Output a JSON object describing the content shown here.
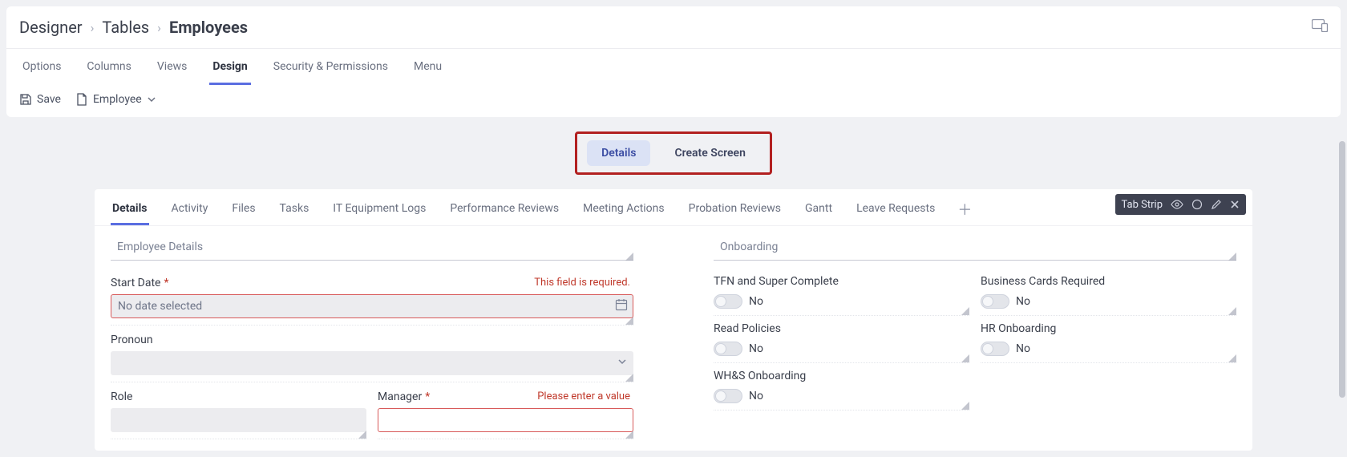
{
  "breadcrumbs": {
    "root": "Designer",
    "mid": "Tables",
    "current": "Employees"
  },
  "main_tabs": [
    "Options",
    "Columns",
    "Views",
    "Design",
    "Security & Permissions",
    "Menu"
  ],
  "main_tabs_active": "Design",
  "toolbar": {
    "save": "Save",
    "form_picker": "Employee"
  },
  "mode": {
    "details": "Details",
    "create": "Create Screen"
  },
  "inner_tabs": [
    "Details",
    "Activity",
    "Files",
    "Tasks",
    "IT Equipment Logs",
    "Performance Reviews",
    "Meeting Actions",
    "Probation Reviews",
    "Gantt",
    "Leave Requests"
  ],
  "inner_tabs_active": "Details",
  "float_chip": {
    "label": "Tab Strip"
  },
  "left_section": {
    "title": "Employee Details",
    "start_date": {
      "label": "Start Date",
      "error": "This field is required.",
      "placeholder": "No date selected"
    },
    "pronoun": {
      "label": "Pronoun"
    },
    "role": {
      "label": "Role"
    },
    "manager": {
      "label": "Manager",
      "error": "Please enter a value"
    }
  },
  "right_section": {
    "title": "Onboarding",
    "fields": {
      "tfn": {
        "label": "TFN and Super Complete",
        "value": "No"
      },
      "cards": {
        "label": "Business Cards Required",
        "value": "No"
      },
      "policies": {
        "label": "Read Policies",
        "value": "No"
      },
      "hr": {
        "label": "HR Onboarding",
        "value": "No"
      },
      "whs": {
        "label": "WH&S Onboarding",
        "value": "No"
      }
    }
  }
}
